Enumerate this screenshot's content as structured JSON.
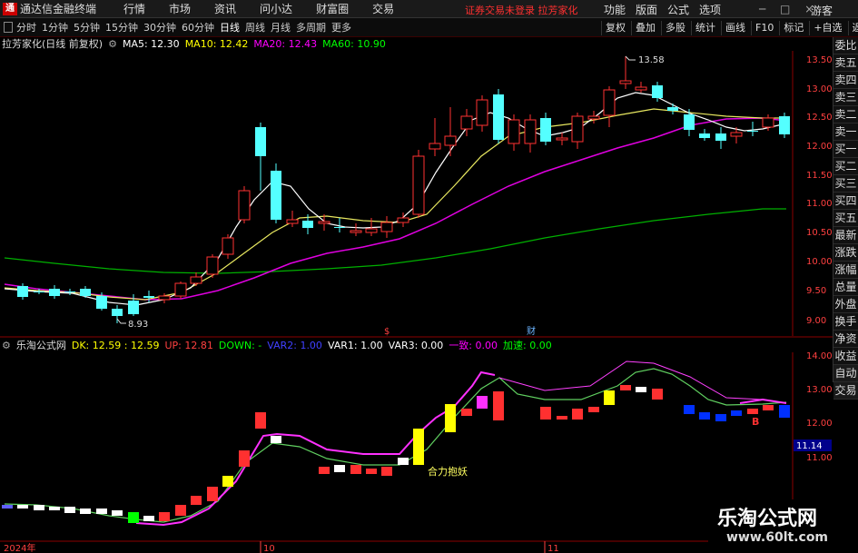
{
  "menubar": {
    "app_title": "通达信金融终端",
    "logo_text": "通",
    "menus": [
      "行情",
      "市场",
      "资讯",
      "问小达",
      "财富圈",
      "交易"
    ],
    "status_warning": "证券交易未登录 拉芳家化",
    "right_menus": [
      "功能",
      "版面",
      "公式",
      "选项"
    ],
    "window_controls": "─ □ ×",
    "guest_label": "游客"
  },
  "toolbar": {
    "periods": [
      "分时",
      "1分钟",
      "5分钟",
      "15分钟",
      "30分钟",
      "60分钟",
      "日线",
      "周线",
      "月线",
      "多周期",
      "更多"
    ],
    "active_period": "日线",
    "right_tools": [
      "复权",
      "叠加",
      "多股",
      "统计",
      "画线",
      "F10",
      "标记",
      "+自选",
      "返回"
    ]
  },
  "main_info": {
    "stock": "拉芳家化(日线 前复权)",
    "ma5": "MA5: 12.30",
    "ma10": "MA10: 12.42",
    "ma20": "MA20: 12.43",
    "ma60": "MA60: 10.90",
    "ma5_color": "#ffffff",
    "ma10_color": "#ffff00",
    "ma20_color": "#ff00ff",
    "ma60_color": "#00ff00"
  },
  "sub_info": {
    "formula": "乐淘公式网",
    "dk": "DK: 12.59 : 12.59",
    "up": "UP: 12.81",
    "down": "DOWN: -",
    "var2": "VAR2: 1.00",
    "var1": "VAR1: 1.00",
    "var3": "VAR3: 0.00",
    "yizhi": "一致: 0.00",
    "jiasu": "加速: 0.00"
  },
  "main_axis": [
    "13.50",
    "13.00",
    "12.50",
    "12.00",
    "11.50",
    "11.00",
    "10.50",
    "10.00",
    "9.50",
    "9.00"
  ],
  "sub_axis": [
    "14.00",
    "13.00",
    "12.00",
    "11.00"
  ],
  "sub_current_value": "11.14",
  "annotations": {
    "high": "13.58",
    "low": "8.93",
    "marker_s": "$",
    "marker_cai": "财",
    "pattern_label": "合力抱妖",
    "b_label": "B"
  },
  "time_axis": [
    "2024年",
    "10",
    "11"
  ],
  "side_panel": [
    "委比",
    "卖五",
    "卖四",
    "卖三",
    "卖二",
    "卖一",
    "买一",
    "买二",
    "买三",
    "买四",
    "买五",
    "最新",
    "涨跌",
    "涨幅",
    "总量",
    "外盘",
    "换手",
    "净资",
    "收益"
  ],
  "side_panel_bottom": [
    "自动",
    "交易"
  ],
  "watermark": {
    "title": "乐淘公式网",
    "url": "www.60lt.com"
  },
  "colors": {
    "up_candle": "#ff3232",
    "down_candle": "#54ffff",
    "accent_red": "#ff3030"
  }
}
